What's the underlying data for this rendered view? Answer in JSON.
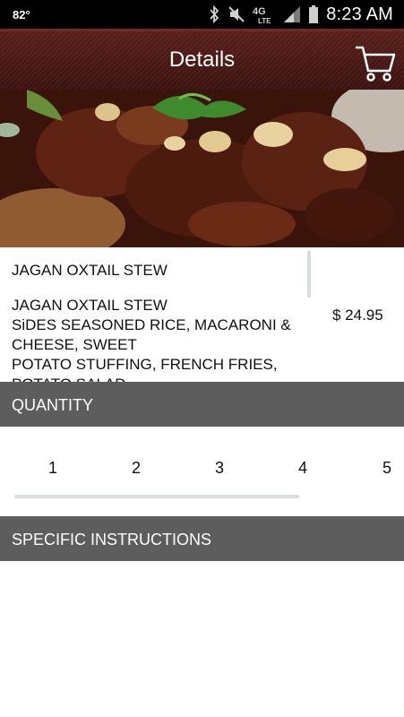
{
  "status_bar": {
    "temperature": "82°",
    "network": "4G LTE",
    "time": "8:23 AM"
  },
  "header": {
    "title": "Details",
    "cart_icon": "shopping-cart-icon"
  },
  "item": {
    "name": "JAGAN OXTAIL STEW",
    "description_lines": [
      "JAGAN OXTAIL STEW",
      "SiDES SEASONED RICE, MACARONI &",
      "CHEESE, SWEET",
      "POTATO STUFFING, FRENCH FRIES,",
      "POTATO SALAD"
    ],
    "price": "$ 24.95"
  },
  "quantity": {
    "heading": "QUANTITY",
    "options": [
      "1",
      "2",
      "3",
      "4",
      "5"
    ]
  },
  "instructions": {
    "heading": "SPECIFIC INSTRUCTIONS"
  },
  "colors": {
    "header_brown": "#4a1714",
    "section_gray": "#5d5d5d",
    "divider_gray": "#d8dde0"
  }
}
